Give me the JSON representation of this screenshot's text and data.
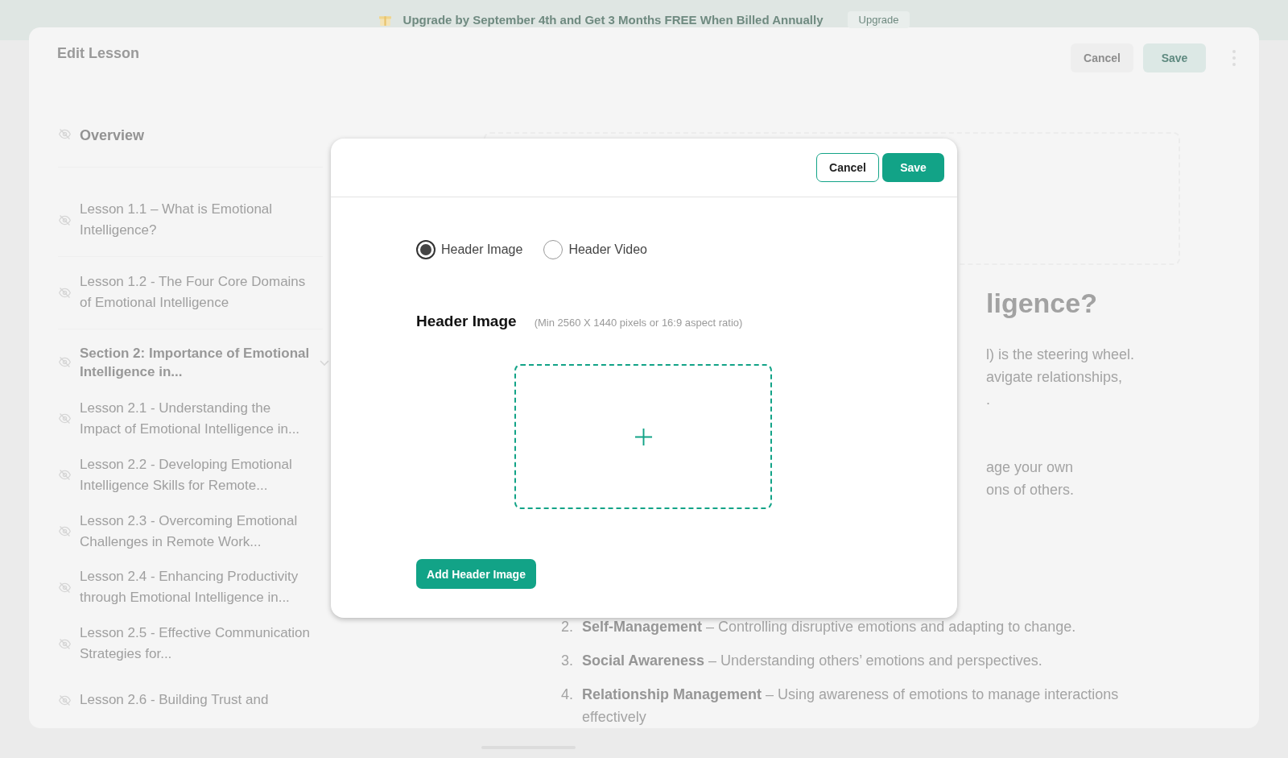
{
  "banner": {
    "text": "Upgrade by September 4th and Get 3 Months FREE When Billed Annually",
    "button": "Upgrade"
  },
  "editor": {
    "title": "Edit Lesson",
    "cancel": "Cancel",
    "save": "Save"
  },
  "sidebar": {
    "items": [
      {
        "kind": "overview",
        "label": "Overview",
        "hidden": true
      },
      {
        "kind": "lesson",
        "label": "Lesson 1.1 – What is Emotional Intelligence?",
        "hidden": true
      },
      {
        "kind": "lesson",
        "label": "Lesson 1.2 - The Four Core Domains of Emotional Intelligence",
        "hidden": true
      },
      {
        "kind": "section",
        "label": "Section 2: Importance of Emotional Intelligence in...",
        "hidden": true,
        "expanded": true
      },
      {
        "kind": "lesson",
        "label": "Lesson 2.1 - Understanding the Impact of Emotional Intelligence in...",
        "hidden": true
      },
      {
        "kind": "lesson",
        "label": "Lesson 2.2 - Developing Emotional Intelligence Skills for Remote...",
        "hidden": true
      },
      {
        "kind": "lesson",
        "label": "Lesson 2.3 - Overcoming Emotional Challenges in Remote Work...",
        "hidden": true
      },
      {
        "kind": "lesson",
        "label": "Lesson 2.4 - Enhancing Productivity through Emotional Intelligence in...",
        "hidden": true
      },
      {
        "kind": "lesson",
        "label": "Lesson 2.5 - Effective Communication Strategies for...",
        "hidden": true
      },
      {
        "kind": "lesson",
        "label": "Lesson 2.6 - Building Trust and",
        "hidden": true
      }
    ]
  },
  "content": {
    "heading": "ligence?",
    "paragraph_lines": [
      "l) is the steering wheel.",
      "avigate relationships,",
      "."
    ],
    "paragraph_lines_2": [
      "age your own",
      "ons of others."
    ],
    "list": [
      {
        "number": "2.",
        "text": "**Self-Management** – Controlling disruptive emotions and adapting to change."
      },
      {
        "number": "3.",
        "text": "**Social Awareness** – Understanding others’ emotions and perspectives."
      },
      {
        "number": "4.",
        "text": "**Relationship Management** – Using awareness of emotions to manage interactions effectively"
      }
    ]
  },
  "modal": {
    "cancel": "Cancel",
    "save": "Save",
    "media_options": [
      {
        "label": "Header Image",
        "selected": true
      },
      {
        "label": "Header Video",
        "selected": false
      }
    ],
    "section_title": "Header Image",
    "hint": "(Min 2560 X 1440 pixels or 16:9 aspect ratio)",
    "add_button": "Add Header Image"
  }
}
